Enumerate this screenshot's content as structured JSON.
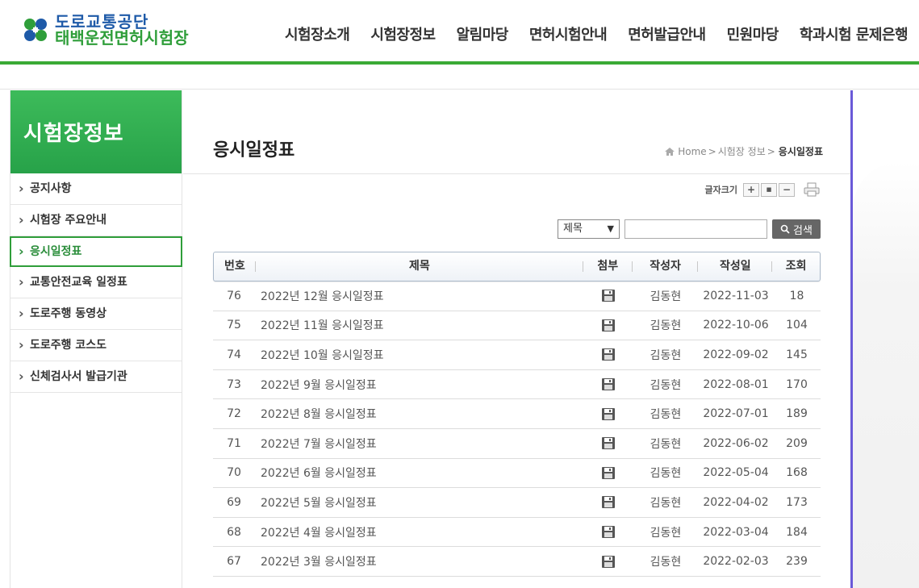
{
  "brand": {
    "line1": "도로교통공단",
    "line2": "태백운전면허시험장",
    "colors": {
      "blue": "#1e5aa8",
      "green": "#2f9e3a"
    }
  },
  "gnb": [
    "시험장소개",
    "시험장정보",
    "알림마당",
    "면허시험안내",
    "면허발급안내",
    "민원마당",
    "학과시험 문제은행"
  ],
  "sidebar": {
    "title": "시험장정보",
    "items": [
      {
        "label": "공지사항",
        "active": false
      },
      {
        "label": "시험장 주요안내",
        "active": false
      },
      {
        "label": "응시일정표",
        "active": true
      },
      {
        "label": "교통안전교육 일정표",
        "active": false
      },
      {
        "label": "도로주행 동영상",
        "active": false
      },
      {
        "label": "도로주행 코스도",
        "active": false
      },
      {
        "label": "신체검사서 발급기관",
        "active": false
      }
    ]
  },
  "page": {
    "title": "응시일정표",
    "breadcrumb": {
      "home": "Home",
      "sep": ">",
      "parent": "시험장 정보",
      "current": "응시일정표"
    }
  },
  "font_tools": {
    "label": "글자크기",
    "plus": "+",
    "reset": "■",
    "minus": "−"
  },
  "search": {
    "select_value": "제목",
    "button_label": "검색",
    "input_value": ""
  },
  "table": {
    "headers": {
      "no": "번호",
      "title": "제목",
      "file": "첨부",
      "writer": "작성자",
      "date": "작성일",
      "hit": "조회"
    },
    "rows": [
      {
        "no": "76",
        "title": "2022년 12월 응시일정표",
        "writer": "김동현",
        "date": "2022-11-03",
        "hit": "18"
      },
      {
        "no": "75",
        "title": "2022년 11월 응시일정표",
        "writer": "김동현",
        "date": "2022-10-06",
        "hit": "104"
      },
      {
        "no": "74",
        "title": "2022년 10월 응시일정표",
        "writer": "김동현",
        "date": "2022-09-02",
        "hit": "145"
      },
      {
        "no": "73",
        "title": "2022년 9월 응시일정표",
        "writer": "김동현",
        "date": "2022-08-01",
        "hit": "170"
      },
      {
        "no": "72",
        "title": "2022년 8월 응시일정표",
        "writer": "김동현",
        "date": "2022-07-01",
        "hit": "189"
      },
      {
        "no": "71",
        "title": "2022년 7월 응시일정표",
        "writer": "김동현",
        "date": "2022-06-02",
        "hit": "209"
      },
      {
        "no": "70",
        "title": "2022년 6월 응시일정표",
        "writer": "김동현",
        "date": "2022-05-04",
        "hit": "168"
      },
      {
        "no": "69",
        "title": "2022년 5월 응시일정표",
        "writer": "김동현",
        "date": "2022-04-02",
        "hit": "173"
      },
      {
        "no": "68",
        "title": "2022년 4월 응시일정표",
        "writer": "김동현",
        "date": "2022-03-04",
        "hit": "184"
      },
      {
        "no": "67",
        "title": "2022년 3월 응시일정표",
        "writer": "김동현",
        "date": "2022-02-03",
        "hit": "239"
      }
    ]
  },
  "icons": {
    "logo": "clover-logo-icon",
    "home": "home-icon",
    "print": "print-icon",
    "search": "search-icon",
    "file": "floppy-disk-icon",
    "arrow": "chevron-right-icon"
  }
}
